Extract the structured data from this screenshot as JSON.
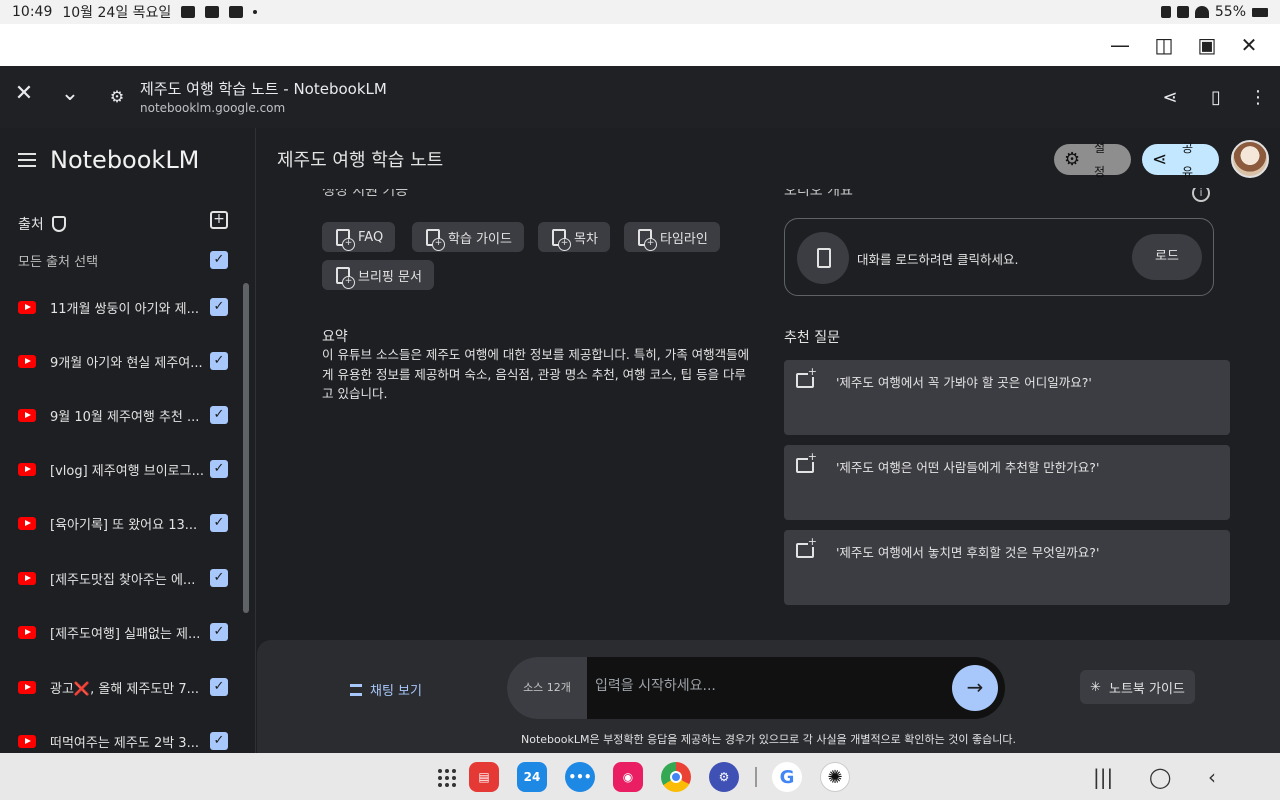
{
  "status_bar": {
    "time": "10:49",
    "date": "10월 24일 목요일",
    "battery": "55%"
  },
  "browser": {
    "page_title": "제주도 여행 학습 노트 - NotebookLM",
    "url": "notebooklm.google.com"
  },
  "sidebar": {
    "logo": "NotebookLM",
    "sources_label": "출처",
    "select_all_label": "모든 출처 선택",
    "items": [
      {
        "label": "11개월 쌍둥이 아기와 제..."
      },
      {
        "label": "9개월 아기와 현실 제주여..."
      },
      {
        "label": "9월 10월 제주여행 추천 ..."
      },
      {
        "label": "[vlog] 제주여행 브이로그..."
      },
      {
        "label": "[육아기록] 또 왔어요 13..."
      },
      {
        "label": "[제주도맛집 찾아주는 에..."
      },
      {
        "label": "[제주도여행] 실패없는 제..."
      },
      {
        "label": "광고❌, 올해 제주도만 7..."
      },
      {
        "label": "떠먹여주는 제주도 2박 3..."
      }
    ]
  },
  "header": {
    "notebook_title": "제주도 여행 학습 노트",
    "settings_label": "설정",
    "share_label": "공유"
  },
  "main": {
    "partial_left_heading": "생성 지원 기능",
    "partial_right_heading": "오디오 개요",
    "chips": [
      "FAQ",
      "학습 가이드",
      "목차",
      "타임라인",
      "브리핑 문서"
    ],
    "summary_title": "요약",
    "summary_text": "이 유튜브 소스들은 제주도 여행에 대한 정보를 제공합니다. 특히, 가족 여행객들에게 유용한 정보를 제공하며 숙소, 음식점, 관광 명소 추천, 여행 코스, 팁 등을 다루고 있습니다.",
    "audio_text": "대화를 로드하려면 클릭하세요.",
    "load_label": "로드",
    "suggested_title": "추천 질문",
    "questions": [
      "'제주도 여행에서 꼭 가봐야 할 곳은 어디일까요?'",
      "'제주도 여행은 어떤 사람들에게 추천할 만한가요?'",
      "'제주도 여행에서 놓치면 후회할 것은 무엇일까요?'"
    ]
  },
  "chat": {
    "chat_view_label": "채팅 보기",
    "source_count": "소스 12개",
    "input_placeholder": "입력을 시작하세요...",
    "guide_label": "노트북 가이드",
    "disclaimer": "NotebookLM은 부정확한 응답을 제공하는 경우가 있으므로 각 사실을 개별적으로 확인하는 것이 좋습니다."
  },
  "dock": {
    "calendar_day": "24",
    "google_letter": "G"
  }
}
